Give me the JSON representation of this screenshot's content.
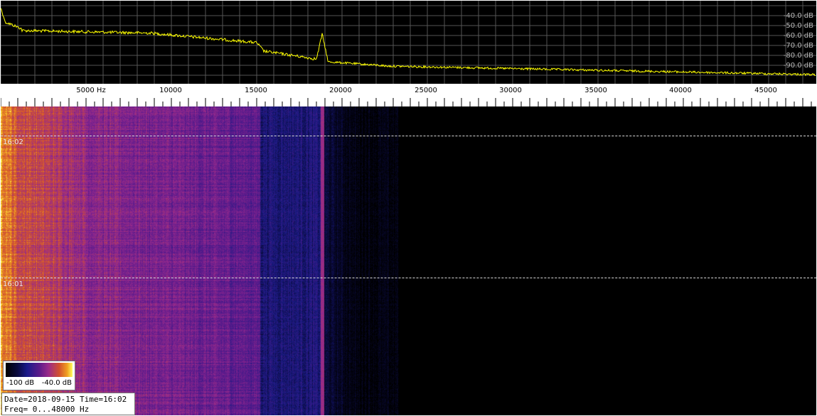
{
  "spectrum": {
    "db_labels": [
      "-40.0 dB",
      "-50.0 dB",
      "-60.0 dB",
      "-70.0 dB",
      "-80.0 dB",
      "-90.0 dB"
    ],
    "trace_color": "#ffff00",
    "grid_color": "#555555",
    "background": "#000000"
  },
  "frequency_axis": {
    "labels": [
      "5000 Hz",
      "10000",
      "15000",
      "20000",
      "25000",
      "30000",
      "35000",
      "40000",
      "45000"
    ]
  },
  "waterfall": {
    "time_markers": [
      "16:02",
      "16:01"
    ],
    "signal_line_color": "#d8406a"
  },
  "colorbar": {
    "min_label": "-100 dB",
    "max_label": "-40.0 dB"
  },
  "info": {
    "line1": "Date=2018-09-15 Time=16:02",
    "line2": "Freq= 0...48000 Hz"
  }
}
